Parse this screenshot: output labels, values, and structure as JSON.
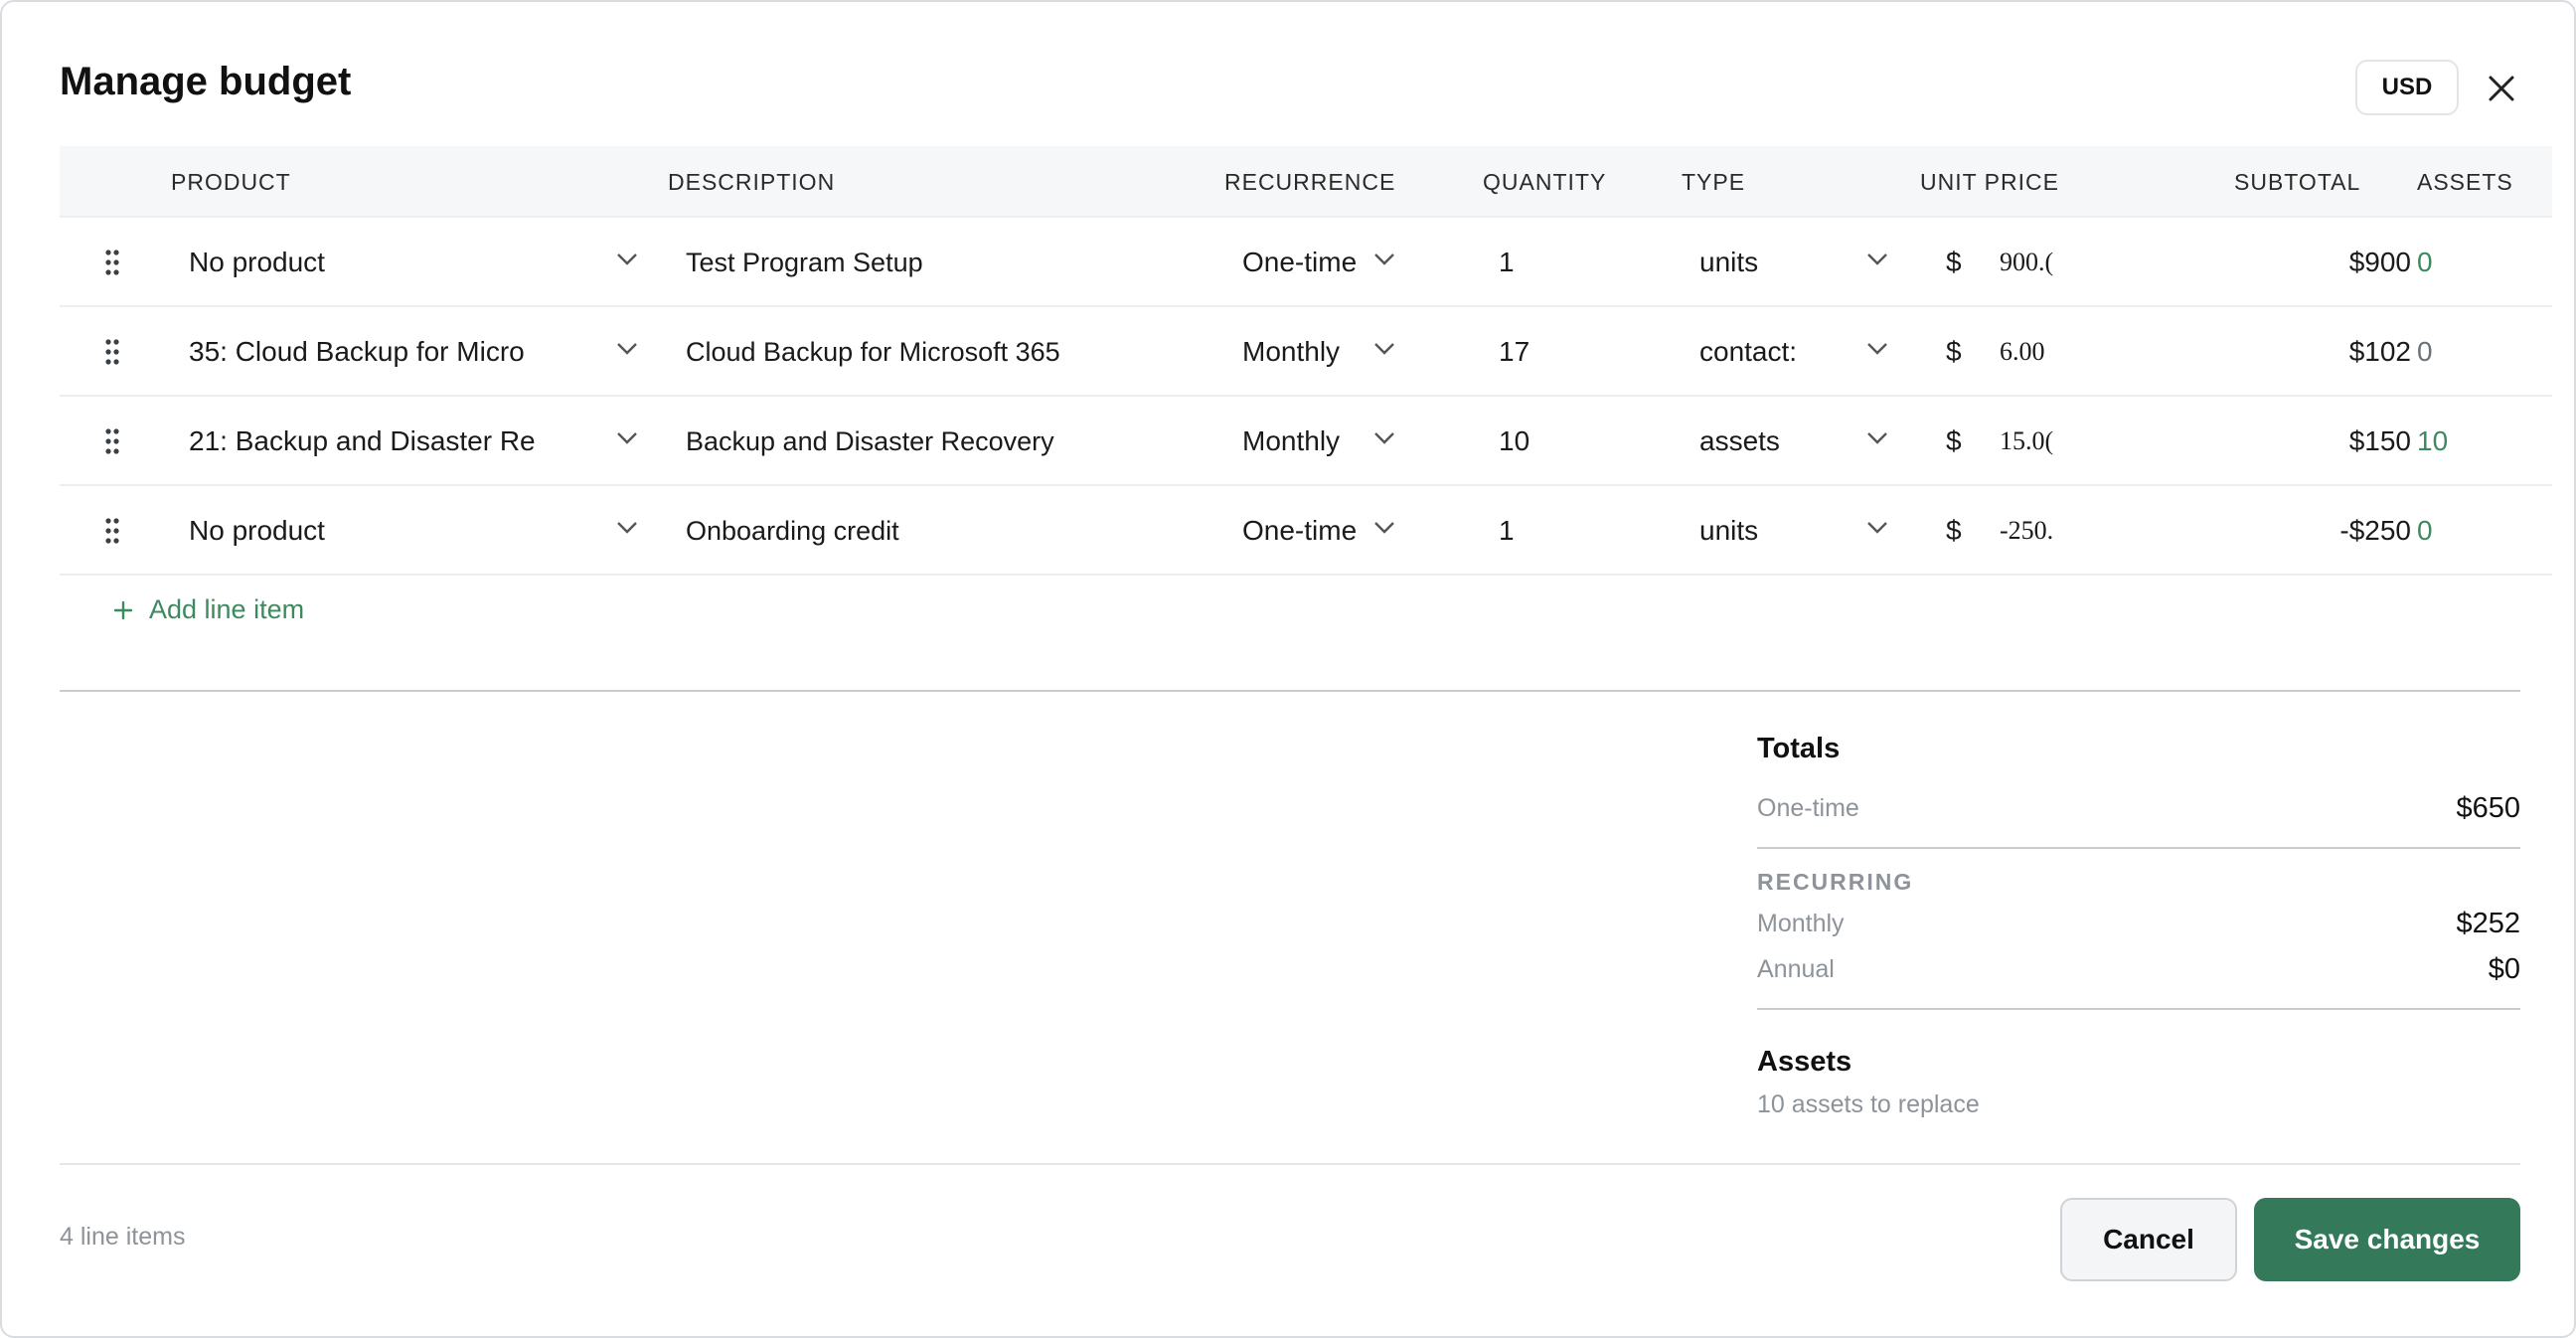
{
  "dialog": {
    "title": "Manage budget",
    "currency": "USD"
  },
  "table": {
    "headers": {
      "product": "PRODUCT",
      "description": "DESCRIPTION",
      "recurrence": "RECURRENCE",
      "quantity": "QUANTITY",
      "type": "TYPE",
      "unit_price": "UNIT PRICE",
      "subtotal": "SUBTOTAL",
      "assets": "ASSETS"
    },
    "rows": [
      {
        "product": "No product",
        "description": "Test Program Setup",
        "recurrence": "One-time",
        "quantity": "1",
        "type": "units",
        "currency_symbol": "$",
        "unit_price": "900.(",
        "subtotal": "$900",
        "assets": "0"
      },
      {
        "product": "35: Cloud Backup for Micro",
        "description": "Cloud Backup for Microsoft 365",
        "recurrence": "Monthly",
        "quantity": "17",
        "type": "contact:",
        "currency_symbol": "$",
        "unit_price": "6.00",
        "subtotal": "$102",
        "assets": "0"
      },
      {
        "product": "21: Backup and Disaster Re",
        "description": "Backup and Disaster Recovery",
        "recurrence": "Monthly",
        "quantity": "10",
        "type": "assets",
        "currency_symbol": "$",
        "unit_price": "15.0(",
        "subtotal": "$150",
        "assets": "10"
      },
      {
        "product": "No product",
        "description": "Onboarding credit",
        "recurrence": "One-time",
        "quantity": "1",
        "type": "units",
        "currency_symbol": "$",
        "unit_price": "-250.",
        "subtotal": "-$250",
        "assets": "0"
      }
    ],
    "add_line_label": "Add line item"
  },
  "totals": {
    "title": "Totals",
    "one_time_label": "One-time",
    "one_time_value": "$650",
    "recurring_label": "RECURRING",
    "monthly_label": "Monthly",
    "monthly_value": "$252",
    "annual_label": "Annual",
    "annual_value": "$0",
    "assets_title": "Assets",
    "assets_sub": "10 assets to replace"
  },
  "footer": {
    "line_count": "4 line items",
    "cancel_label": "Cancel",
    "save_label": "Save changes"
  },
  "colors": {
    "accent": "#33795a",
    "assets_link": "#3d8a5f"
  }
}
